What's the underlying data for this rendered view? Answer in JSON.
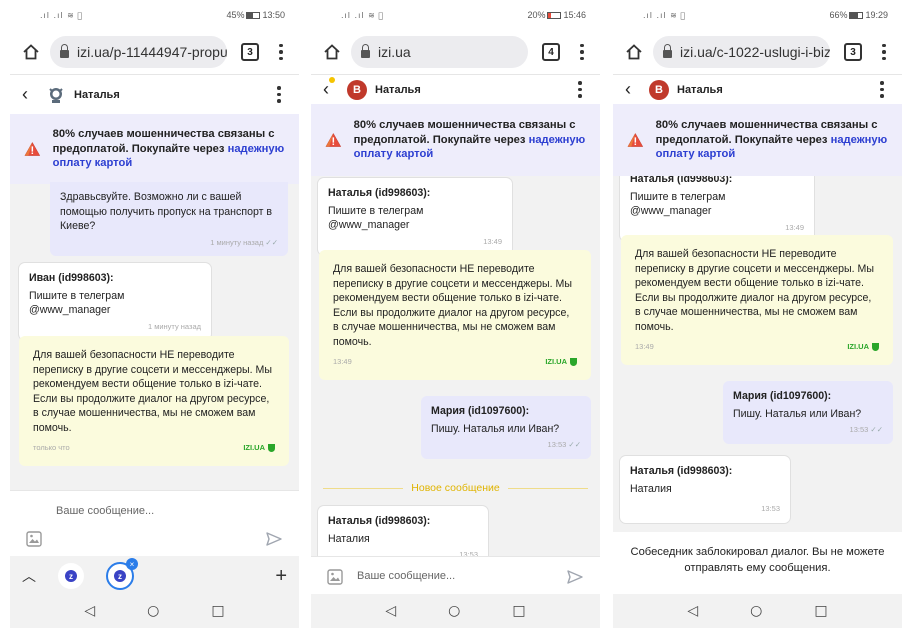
{
  "status": [
    {
      "signal": ".ıl .ıl ≋ ⃞",
      "battery": "45%",
      "battery_level": 0.45,
      "time": "13:50"
    },
    {
      "signal": ".ıl .ıl ≋ ⃞",
      "battery": "20%",
      "battery_level": 0.2,
      "time": "15:46"
    },
    {
      "signal": ".ıl .ıl ≋ ⃞",
      "battery": "66%",
      "battery_level": 0.66,
      "time": "19:29"
    }
  ],
  "urls": [
    "izi.ua/p-11444947-propu",
    "izi.ua",
    "izi.ua/c-1022-uslugi-i-biz"
  ],
  "tab_count": "3",
  "tab_counts": [
    "3",
    "4",
    "3"
  ],
  "contact_name": "Наталья",
  "avatar_letter": "В",
  "warning": {
    "line": "80% случаев мошенничества связаны с предоплатой. Покупайте через ",
    "link": "надежную оплату картой"
  },
  "screen1": {
    "m1_text": "Здравьсвуйте. Возможно ли с вашей помощью получить пропуск на транспорт в Киеве?",
    "m1_time": "1 минуту назад",
    "m2_sender": "Иван (id998603):",
    "m2_text": "Пишите в телеграм @www_manager",
    "m2_time": "1 минуту назад",
    "sys_text": "Для вашей безопасности НЕ переводите переписку в другие соцсети и мессенджеры. Мы рекомендуем вести общение только в izi-чате. Если вы продолжите диалог на другом ресурсе, в случае мошенничества, мы не сможем вам помочь.",
    "sys_time": "только что",
    "sys_brand": "IZI.UA",
    "input_placeholder": "Ваше сообщение..."
  },
  "screen2": {
    "m1_sender": "Наталья (id998603):",
    "m1_text": "Пишите в телеграм @www_manager",
    "m1_time": "13:49",
    "sys_text": "Для вашей безопасности НЕ переводите переписку в другие соцсети и мессенджеры. Мы рекомендуем вести общение только в izi-чате. Если вы продолжите диалог на другом ресурсе, в случае мошенничества, мы не сможем вам помочь.",
    "sys_time": "13:49",
    "sys_brand": "IZI.UA",
    "m2_sender": "Мария (id1097600):",
    "m2_text": "Пишу. Наталья или Иван?",
    "m2_time": "13:53",
    "new_label": "Новое сообщение",
    "m3_sender": "Наталья (id998603):",
    "m3_text": "Наталия",
    "m3_time": "13:53",
    "input_placeholder": "Ваше сообщение..."
  },
  "screen3": {
    "m1_sender": "Наталья (id998603):",
    "m1_text": "Пишите в телеграм @www_manager",
    "m1_time": "13:49",
    "sys_text": "Для вашей безопасности НЕ переводите переписку в другие соцсети и мессенджеры. Мы рекомендуем вести общение только в izi-чате. Если вы продолжите диалог на другом ресурсе, в случае мошенничества, мы не сможем вам помочь.",
    "sys_time": "13:49",
    "sys_brand": "IZI.UA",
    "m2_sender": "Мария (id1097600):",
    "m2_text": "Пишу. Наталья или Иван?",
    "m2_time": "13:53",
    "m3_sender": "Наталья (id998603):",
    "m3_text": "Наталия",
    "m3_time": "13:53",
    "blocked_text": "Собеседник заблокировал диалог. Вы не можете отправлять ему сообщения."
  },
  "icons": {
    "read_check": "✓✓",
    "nav_back": "◁",
    "nav_home": "○",
    "nav_recent": "□",
    "toolbar_up": "︿",
    "toolbar_plus": "+"
  },
  "colors": {
    "warning_bg": "#eeedfb",
    "link": "#2d3fd1",
    "system_bubble": "#fbfbdd",
    "my_bubble": "#e8e8fb",
    "brand_green": "#2aa62a",
    "avatar": "#c0392b",
    "new_message": "#e0b400"
  }
}
